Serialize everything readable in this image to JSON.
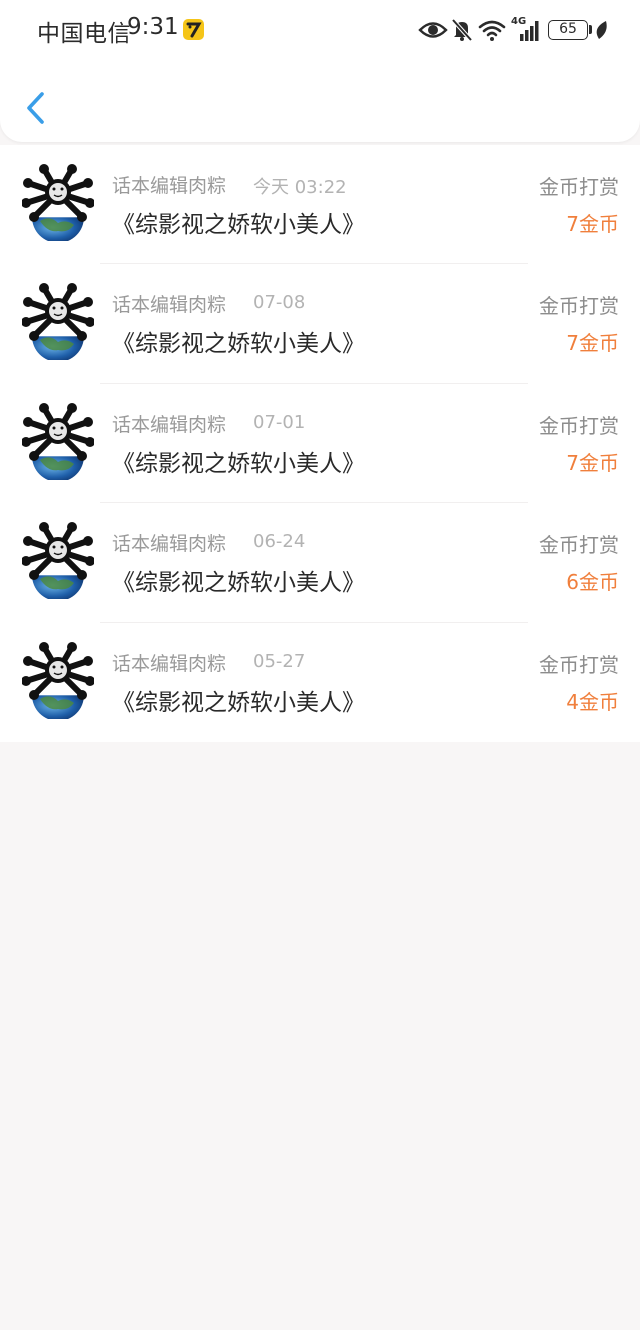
{
  "status_bar": {
    "carrier": "中国电信",
    "time": "9:31",
    "network": "4G",
    "battery": "65",
    "icons": [
      "eye-icon",
      "bell-muted-icon",
      "wifi-icon",
      "signal-icon",
      "battery-icon",
      "leaf-icon"
    ]
  },
  "header": {
    "back_icon": "chevron-left-icon",
    "accent_color": "#3a9ee8"
  },
  "rewards": [
    {
      "editor": "话本编辑肉粽",
      "date": "今天 03:22",
      "book": "《综影视之娇软小美人》",
      "type": "金币打赏",
      "amount": "7金币"
    },
    {
      "editor": "话本编辑肉粽",
      "date": "07-08",
      "book": "《综影视之娇软小美人》",
      "type": "金币打赏",
      "amount": "7金币"
    },
    {
      "editor": "话本编辑肉粽",
      "date": "07-01",
      "book": "《综影视之娇软小美人》",
      "type": "金币打赏",
      "amount": "7金币"
    },
    {
      "editor": "话本编辑肉粽",
      "date": "06-24",
      "book": "《综影视之娇软小美人》",
      "type": "金币打赏",
      "amount": "6金币"
    },
    {
      "editor": "话本编辑肉粽",
      "date": "05-27",
      "book": "《综影视之娇软小美人》",
      "type": "金币打赏",
      "amount": "4金币"
    }
  ],
  "colors": {
    "amount": "#f07f3c",
    "background": "#f8f6f6"
  }
}
